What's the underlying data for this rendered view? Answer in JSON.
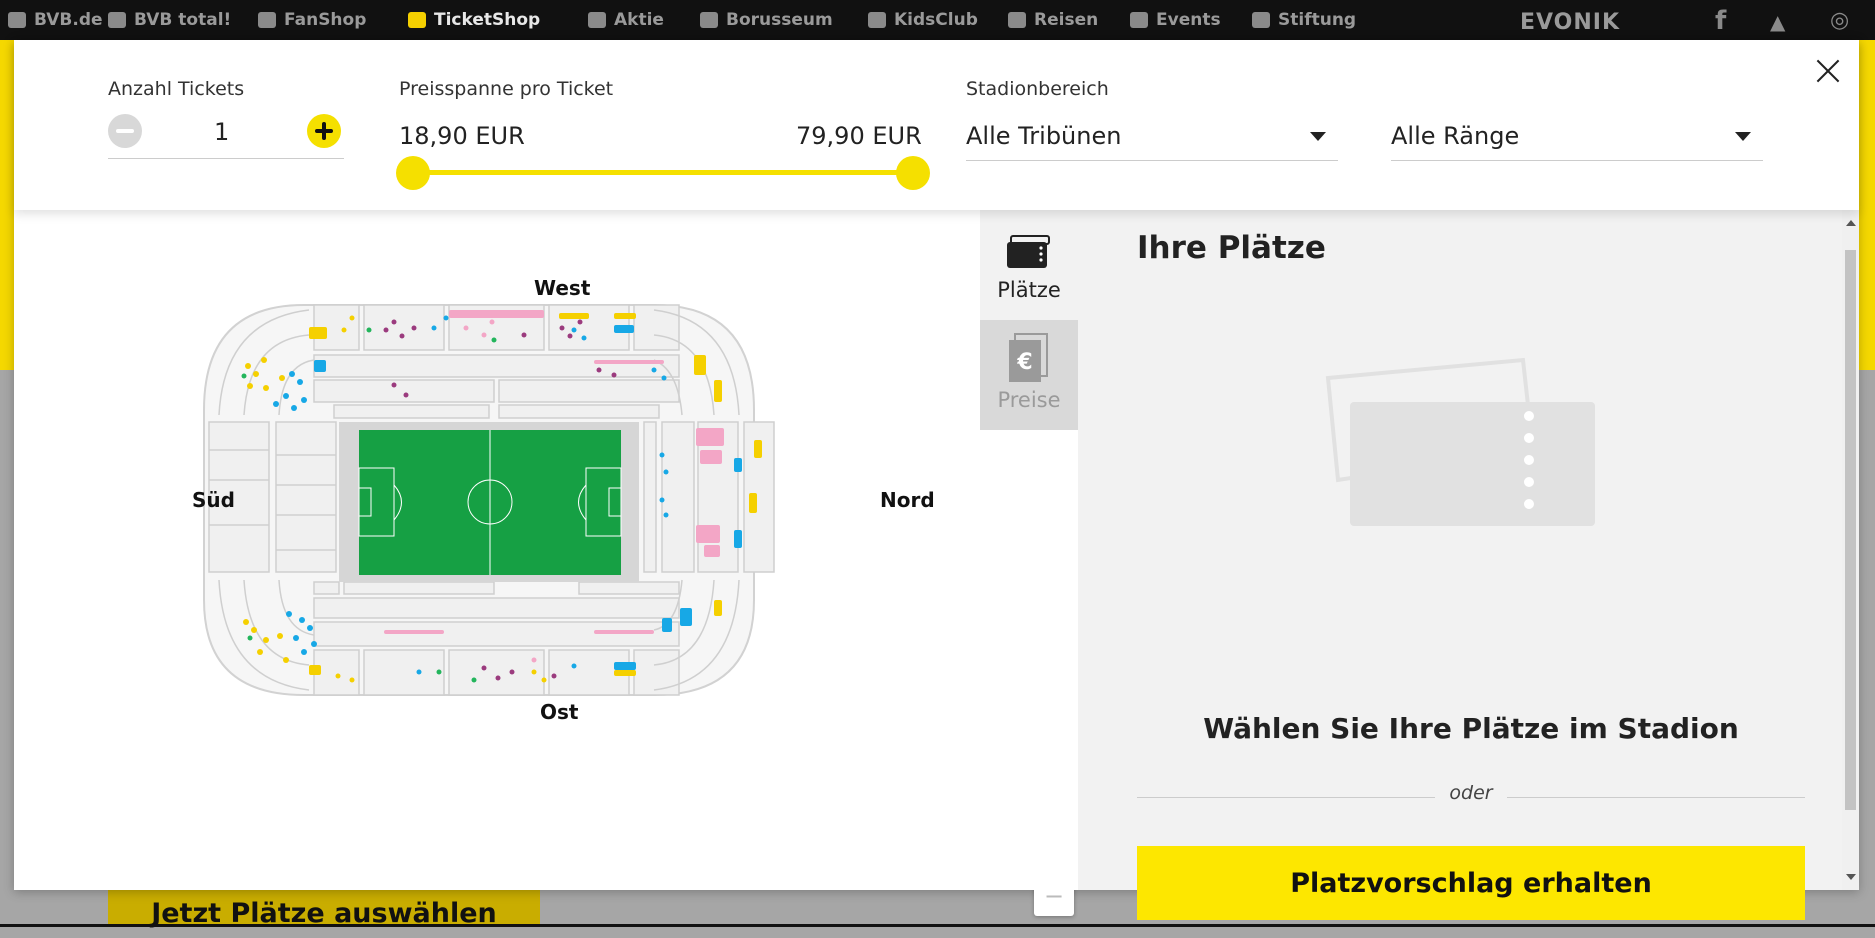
{
  "site_nav": {
    "items": [
      "BVB.de",
      "BVB total!",
      "FanShop",
      "TicketShop",
      "Aktie",
      "Borusseum",
      "KidsClub",
      "Reisen",
      "Events",
      "Stiftung"
    ],
    "active": "TicketShop",
    "sponsor": "EVONIK",
    "social": [
      "f",
      "t",
      "ig"
    ]
  },
  "background": {
    "cta_label": "Jetzt Plätze auswählen"
  },
  "filters": {
    "tickets_label": "Anzahl Tickets",
    "tickets_value": "1",
    "price_label": "Preisspanne pro Ticket",
    "price_min": "18,90 EUR",
    "price_max": "79,90 EUR",
    "area_label": "Stadionbereich",
    "stand_select": "Alle Tribünen",
    "tier_select": "Alle Ränge"
  },
  "map": {
    "stands": {
      "west": "West",
      "ost": "Ost",
      "sued": "Süd",
      "nord": "Nord"
    },
    "zoom_in": "+",
    "zoom_out": "−"
  },
  "tabs": {
    "seats": "Plätze",
    "prices": "Preise"
  },
  "panel": {
    "title": "Ihre Plätze",
    "instruction": "Wählen Sie Ihre Plätze im Stadion",
    "or": "oder",
    "suggest_button": "Platzvorschlag erhalten"
  },
  "colors": {
    "accent": "#fde700",
    "pitch": "#16a044",
    "seat_yellow": "#f5d000",
    "seat_blue": "#17a8e6",
    "seat_pink": "#f3a6c6",
    "seat_purple": "#9b3b7e",
    "seat_green": "#23b55c"
  }
}
